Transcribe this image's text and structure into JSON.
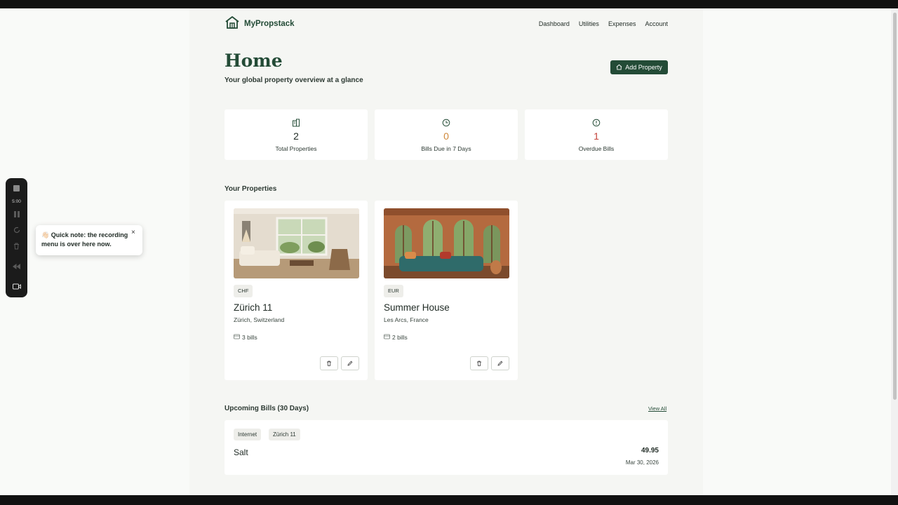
{
  "app": {
    "name": "MyPropstack"
  },
  "nav": {
    "items": [
      "Dashboard",
      "Utilities",
      "Expenses",
      "Account"
    ]
  },
  "header": {
    "title": "Home",
    "subtitle": "Your global property overview at a glance",
    "add_button": "Add Property"
  },
  "stats": [
    {
      "value": "2",
      "label": "Total Properties",
      "color": "#1f2a24",
      "icon": "building-icon"
    },
    {
      "value": "0",
      "label": "Bills Due in 7 Days",
      "color": "#d0893b",
      "icon": "clock-icon"
    },
    {
      "value": "1",
      "label": "Overdue Bills",
      "color": "#c4433b",
      "icon": "alert-circle-icon"
    }
  ],
  "properties_section": {
    "title": "Your Properties"
  },
  "properties": [
    {
      "currency": "CHF",
      "name": "Zürich 11",
      "location": "Zürich, Switzerland",
      "bills": "3 bills"
    },
    {
      "currency": "EUR",
      "name": "Summer House",
      "location": "Les Arcs, France",
      "bills": "2 bills"
    }
  ],
  "upcoming": {
    "title": "Upcoming Bills (30 Days)",
    "view_all": "View All",
    "bills": [
      {
        "tags": [
          "Internet",
          "Zürich 11"
        ],
        "vendor": "Salt",
        "amount": "49.95",
        "date": "Mar 30, 2026"
      }
    ]
  },
  "recorder": {
    "time": "5:00",
    "tooltip": "👋🏻 Quick note: the recording menu is over here now.",
    "close": "×"
  },
  "colors": {
    "brand": "#234b36",
    "warning": "#d0893b",
    "danger": "#c4433b"
  }
}
